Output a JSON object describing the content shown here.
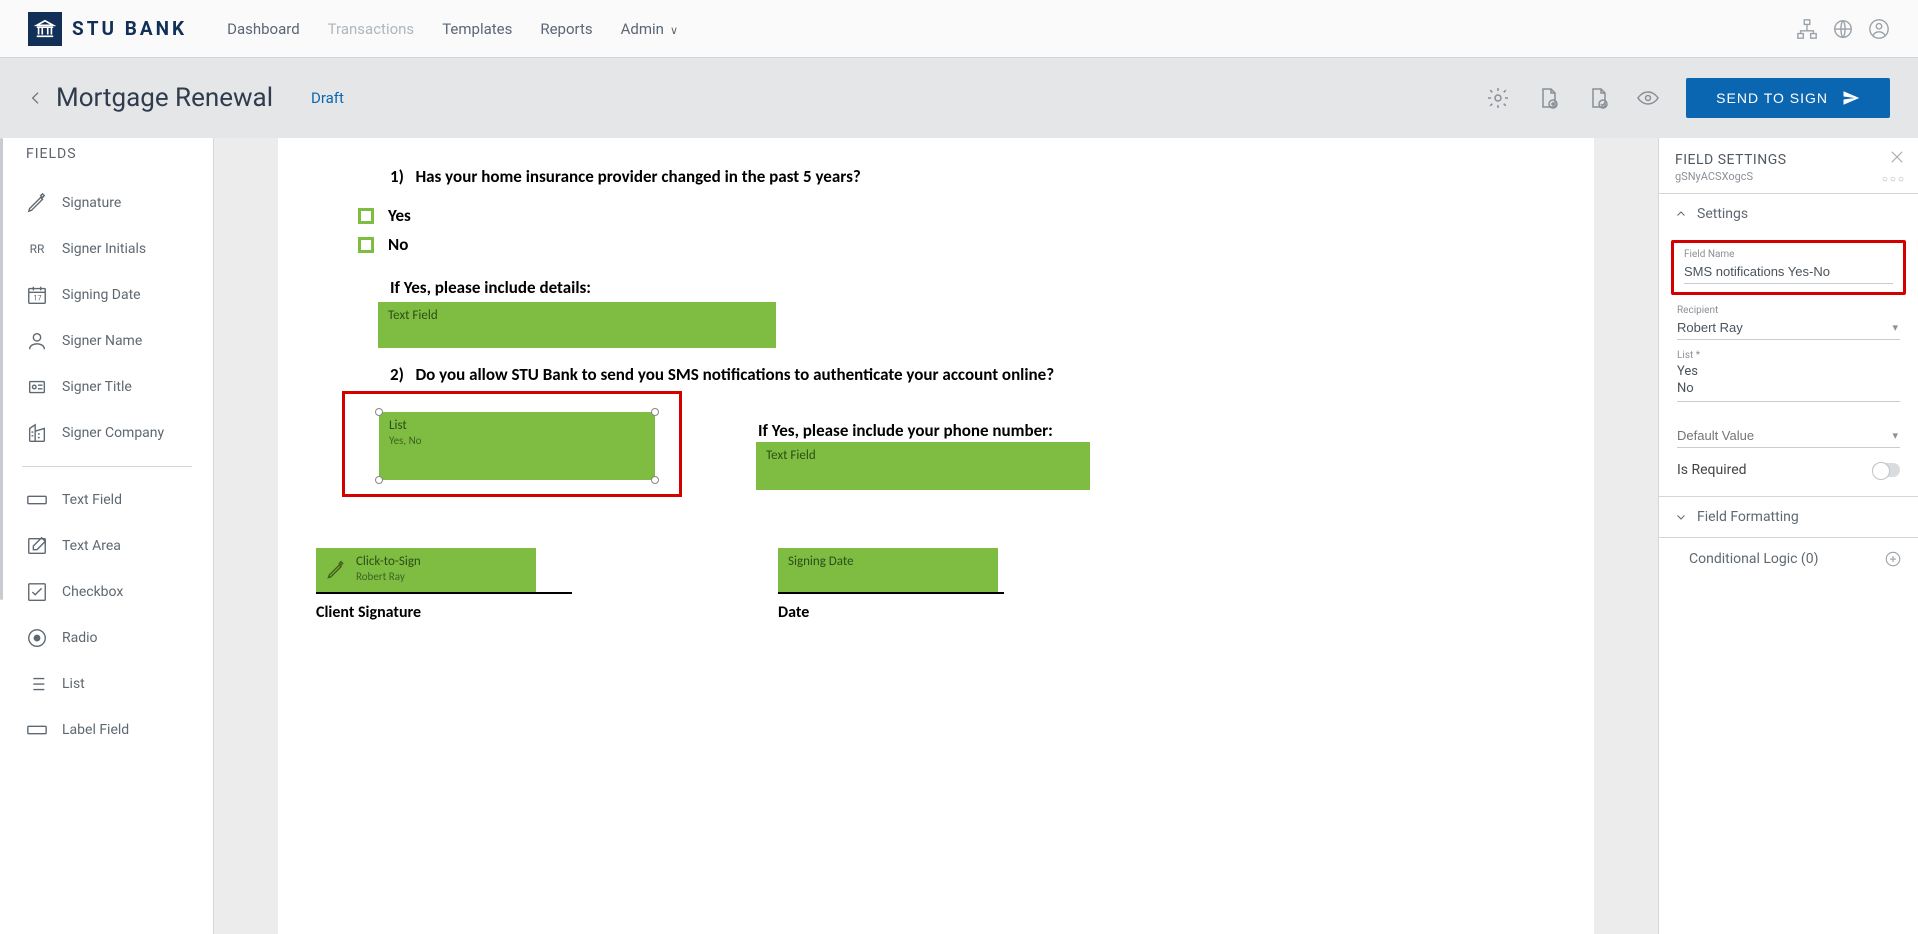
{
  "brand": {
    "name": "STU BANK"
  },
  "topnav": [
    "Dashboard",
    "Transactions",
    "Templates",
    "Reports",
    "Admin"
  ],
  "subheader": {
    "title": "Mortgage Renewal",
    "status": "Draft",
    "send": "SEND TO SIGN"
  },
  "fields_panel": {
    "title": "FIELDS",
    "items": [
      "Signature",
      "Signer Initials",
      "Signing Date",
      "Signer Name",
      "Signer Title",
      "Signer Company"
    ],
    "items2": [
      "Text Field",
      "Text Area",
      "Checkbox",
      "Radio",
      "List",
      "Label Field"
    ],
    "initials_badge": "RR"
  },
  "doc": {
    "q1": "1)   Has your home insurance provider changed in the past 5 years?",
    "yes": "Yes",
    "no": "No",
    "if_yes1": "If Yes, please include details:",
    "text_field_label": "Text Field",
    "q2": "2)   Do you allow STU Bank to send you SMS notifications to authenticate your account online?",
    "list_title": "List",
    "list_vals": "Yes, No",
    "if_yes2": "If Yes, please include your phone number:",
    "cts_title": "Click-to-Sign",
    "cts_name": "Robert Ray",
    "client_sig": "Client Signature",
    "signing_date": "Signing Date",
    "date_label": "Date"
  },
  "settings": {
    "panel_title": "FIELD SETTINGS",
    "panel_sub": "gSNyACSXogcS",
    "section_settings": "Settings",
    "field_name_label": "Field Name",
    "field_name_value": "SMS notifications Yes-No",
    "recipient_label": "Recipient",
    "recipient_value": "Robert Ray",
    "list_label": "List *",
    "list_options": [
      "Yes",
      "No"
    ],
    "default_label": "Default Value",
    "is_required": "Is Required",
    "field_formatting": "Field Formatting",
    "conditional_logic": "Conditional Logic (0)"
  }
}
